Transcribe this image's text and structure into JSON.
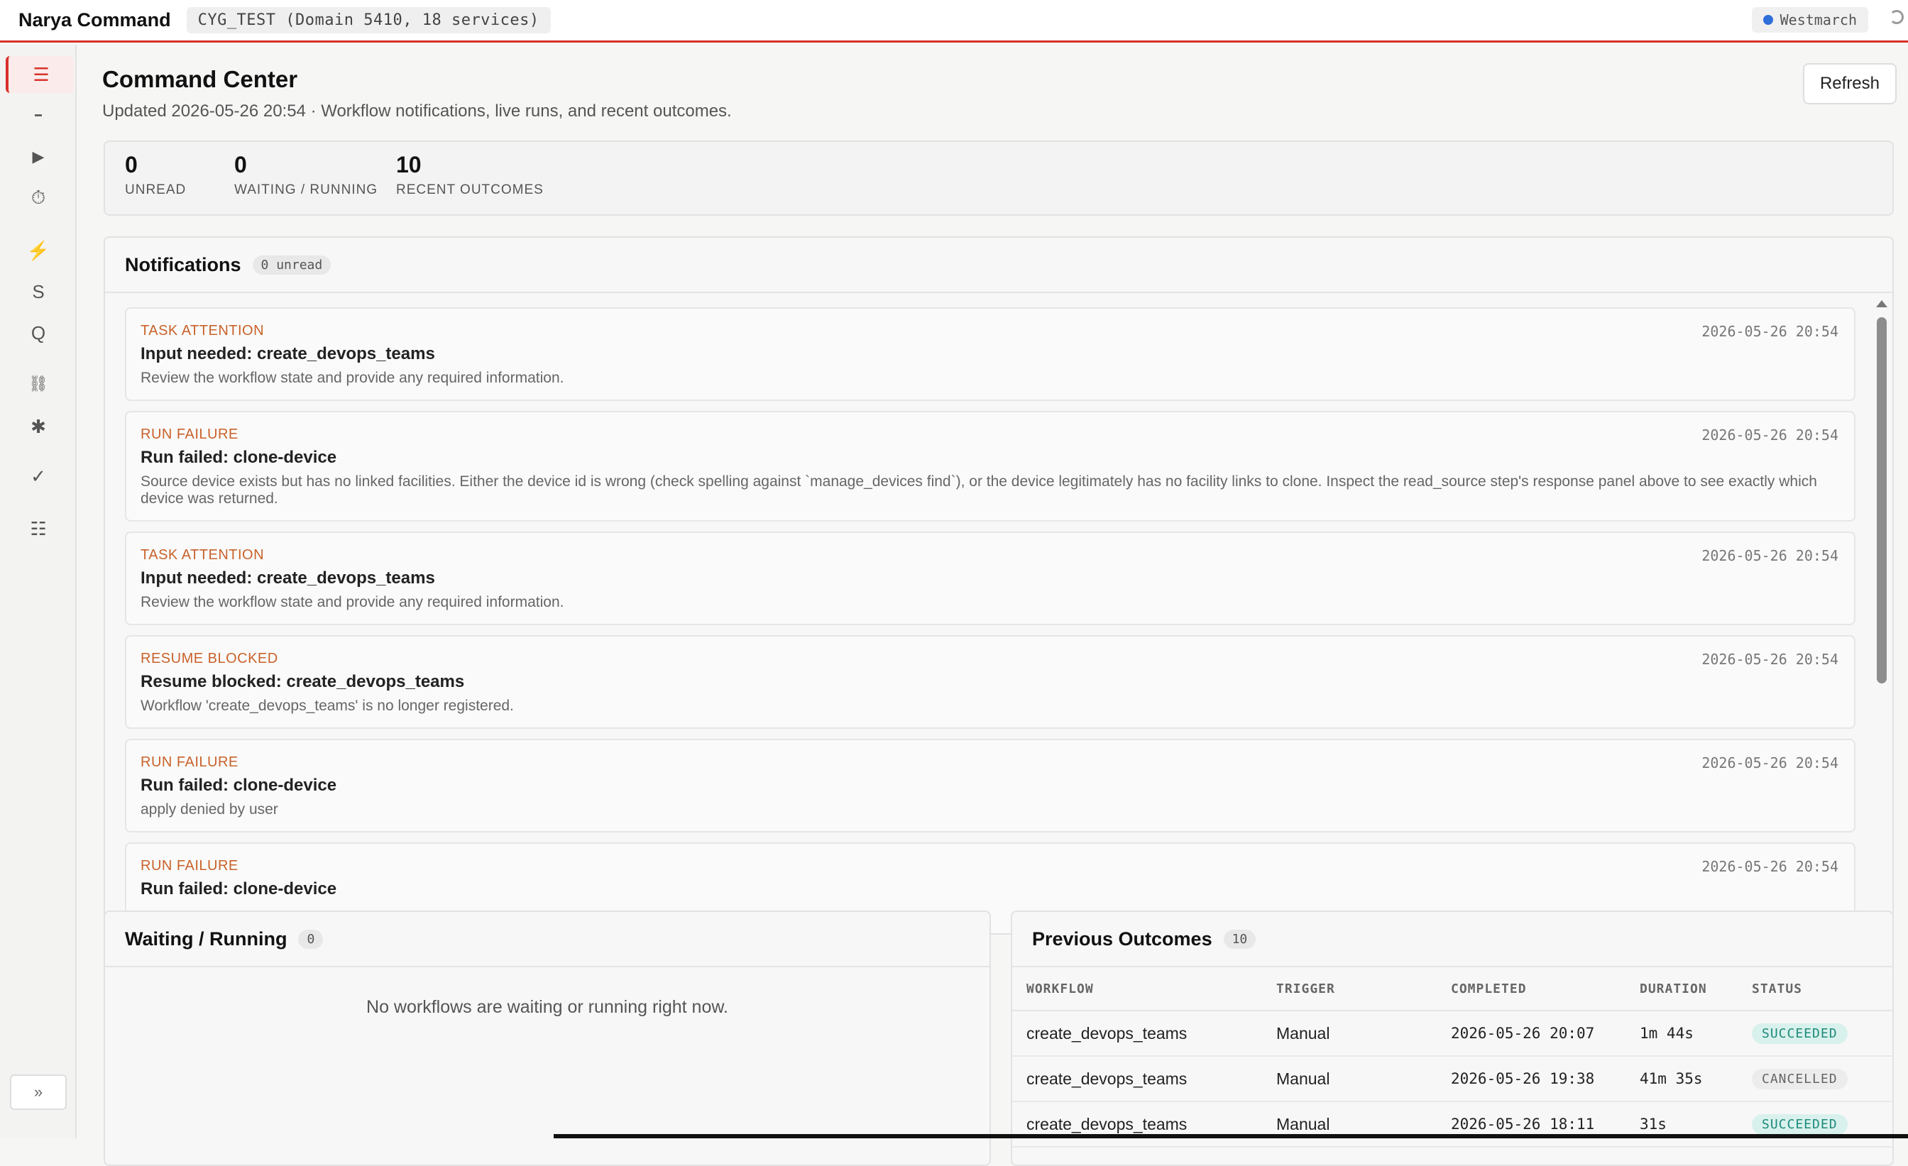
{
  "app": {
    "title": "Narya Command",
    "environment": "CYG_TEST (Domain 5410, 18 services)",
    "region": "Westmarch"
  },
  "sidebar": {
    "items": [
      {
        "name": "menu",
        "glyph": "☰"
      },
      {
        "name": "minus",
        "glyph": "━"
      },
      {
        "name": "play",
        "glyph": "▶"
      },
      {
        "name": "clock",
        "glyph": "⏱"
      },
      {
        "name": "bolt",
        "glyph": "⚡"
      },
      {
        "name": "s",
        "glyph": "S"
      },
      {
        "name": "q",
        "glyph": "Q"
      },
      {
        "name": "link",
        "glyph": "⛓"
      },
      {
        "name": "asterisk",
        "glyph": "✱"
      },
      {
        "name": "check",
        "glyph": "✓"
      },
      {
        "name": "list",
        "glyph": "☷"
      }
    ],
    "expand_glyph": "»"
  },
  "header": {
    "title": "Command Center",
    "subtitle": "Updated 2026-05-26 20:54 · Workflow notifications, live runs, and recent outcomes.",
    "refresh_label": "Refresh"
  },
  "stats": [
    {
      "value": "0",
      "label": "UNREAD"
    },
    {
      "value": "0",
      "label": "WAITING / RUNNING"
    },
    {
      "value": "10",
      "label": "RECENT OUTCOMES"
    }
  ],
  "notifications": {
    "title": "Notifications",
    "badge": "0 unread",
    "items": [
      {
        "type": "TASK ATTENTION",
        "time": "2026-05-26 20:54",
        "title": "Input needed: create_devops_teams",
        "desc": "Review the workflow state and provide any required information."
      },
      {
        "type": "RUN FAILURE",
        "time": "2026-05-26 20:54",
        "title": "Run failed: clone-device",
        "desc": "Source device exists but has no linked facilities. Either the device id is wrong (check spelling against `manage_devices find`), or the device legitimately has no facility links to clone. Inspect the read_source step's response panel above to see exactly which device was returned."
      },
      {
        "type": "TASK ATTENTION",
        "time": "2026-05-26 20:54",
        "title": "Input needed: create_devops_teams",
        "desc": "Review the workflow state and provide any required information."
      },
      {
        "type": "RESUME BLOCKED",
        "time": "2026-05-26 20:54",
        "title": "Resume blocked: create_devops_teams",
        "desc": "Workflow 'create_devops_teams' is no longer registered."
      },
      {
        "type": "RUN FAILURE",
        "time": "2026-05-26 20:54",
        "title": "Run failed: clone-device",
        "desc": "apply denied by user"
      },
      {
        "type": "RUN FAILURE",
        "time": "2026-05-26 20:54",
        "title": "Run failed: clone-device",
        "desc": ""
      }
    ]
  },
  "waiting": {
    "title": "Waiting / Running",
    "badge": "0",
    "empty": "No workflows are waiting or running right now."
  },
  "outcomes": {
    "title": "Previous Outcomes",
    "badge": "10",
    "columns": [
      "WORKFLOW",
      "TRIGGER",
      "COMPLETED",
      "DURATION",
      "STATUS"
    ],
    "rows": [
      {
        "workflow": "create_devops_teams",
        "trigger": "Manual",
        "completed": "2026-05-26 20:07",
        "duration": "1m 44s",
        "status": "SUCCEEDED"
      },
      {
        "workflow": "create_devops_teams",
        "trigger": "Manual",
        "completed": "2026-05-26 19:38",
        "duration": "41m 35s",
        "status": "CANCELLED"
      },
      {
        "workflow": "create_devops_teams",
        "trigger": "Manual",
        "completed": "2026-05-26 18:11",
        "duration": "31s",
        "status": "SUCCEEDED"
      }
    ]
  }
}
